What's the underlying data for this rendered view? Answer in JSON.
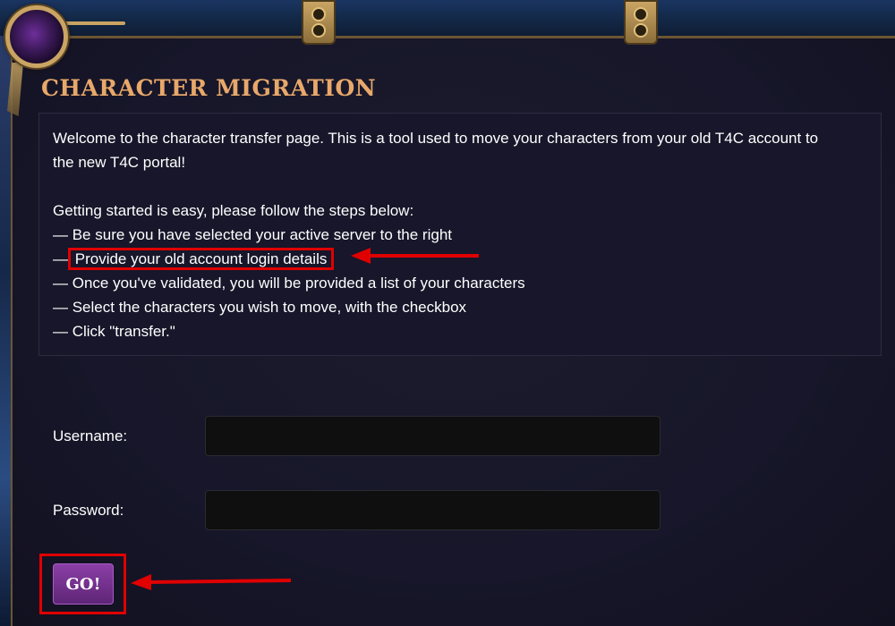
{
  "page": {
    "title": "CHARACTER MIGRATION"
  },
  "info": {
    "intro_line1": "Welcome to the character transfer page. This is a tool used to move your characters from your old T4C account to",
    "intro_line2": "the new T4C portal!",
    "steps_heading": "Getting started is easy, please follow the steps below:",
    "steps": [
      "— Be sure you have selected your active server to the right",
      "Provide your old account login details",
      "— Once you've validated, you will be provided a list of your characters",
      "— Select the characters you wish to move, with the checkbox",
      "— Click \"transfer.\""
    ],
    "step2_prefix": "—"
  },
  "form": {
    "username_label": "Username:",
    "username_value": "",
    "password_label": "Password:",
    "password_value": "",
    "submit_label": "GO!"
  },
  "colors": {
    "title": "#e8a86a",
    "annotation": "#e00000",
    "button": "#7a3392",
    "background": "#17162a"
  },
  "icons": {
    "orb": "purple-orb-icon",
    "hinge": "metal-hinge-icon",
    "arrow": "red-arrow-icon"
  }
}
